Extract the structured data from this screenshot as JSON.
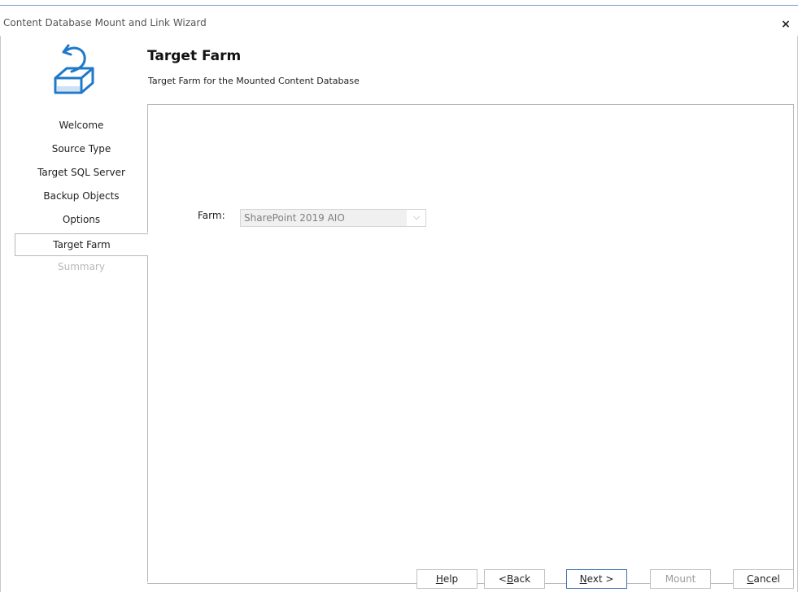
{
  "window": {
    "title": "Content Database Mount and Link Wizard",
    "close_label": "×"
  },
  "header": {
    "title": "Target Farm",
    "subtitle": "Target Farm for the Mounted Content Database",
    "icon": "database-mount-icon"
  },
  "nav": {
    "items": [
      {
        "label": "Welcome",
        "state": "normal"
      },
      {
        "label": "Source Type",
        "state": "normal"
      },
      {
        "label": "Target SQL Server",
        "state": "normal"
      },
      {
        "label": "Backup Objects",
        "state": "normal"
      },
      {
        "label": "Options",
        "state": "normal"
      },
      {
        "label": "Target Farm",
        "state": "active"
      },
      {
        "label": "Summary",
        "state": "disabled"
      }
    ]
  },
  "form": {
    "farm_label": "Farm:",
    "farm_value": "SharePoint 2019 AIO",
    "farm_arrow": "⌵"
  },
  "buttons": {
    "help": {
      "accel": "H",
      "rest": "elp"
    },
    "back": {
      "pre": "< ",
      "accel": "B",
      "rest": "ack"
    },
    "next": {
      "accel": "N",
      "rest": "ext >"
    },
    "mount": "Mount",
    "cancel": {
      "accel": "C",
      "rest": "ancel"
    }
  },
  "colors": {
    "accent": "#3a6fb0",
    "icon_blue": "#1f78c8",
    "disabled_text": "#b8b8b8"
  }
}
